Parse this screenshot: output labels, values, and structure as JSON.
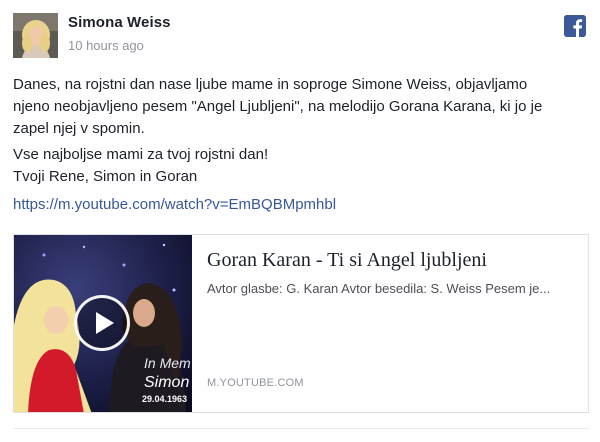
{
  "post": {
    "author": "Simona Weiss",
    "timestamp": "10 hours ago",
    "platform_icon": "facebook-icon",
    "body_lines": [
      "Danes, na rojstni dan nase ljube mame in soproge Simone Weiss, objavljamo",
      "njeno neobjavljeno pesem \"Angel Ljubljeni\", na melodijo Gorana Karana, ki jo je",
      "zapel njej v spomin.",
      "Vse najboljse mami za tvoj rojstni dan!",
      "Tvoji Rene, Simon in Goran"
    ],
    "link_text": "https://m.youtube.com/watch?v=EmBQBMpmhbl"
  },
  "link_card": {
    "title": "Goran Karan - Ti si Angel ljubljeni",
    "description": "Avtor glasbe: G. Karan Avtor besedila: S. Weiss Pesem je...",
    "domain": "M.YOUTUBE.COM",
    "thumbnail_caption_1": "In Mem",
    "thumbnail_caption_2": "Simon",
    "thumbnail_caption_3": "29.04.1963",
    "play_icon": "play-icon"
  },
  "colors": {
    "facebook_blue": "#3b5998",
    "link_blue": "#365899",
    "text": "#1d2129",
    "muted": "#90949c"
  }
}
